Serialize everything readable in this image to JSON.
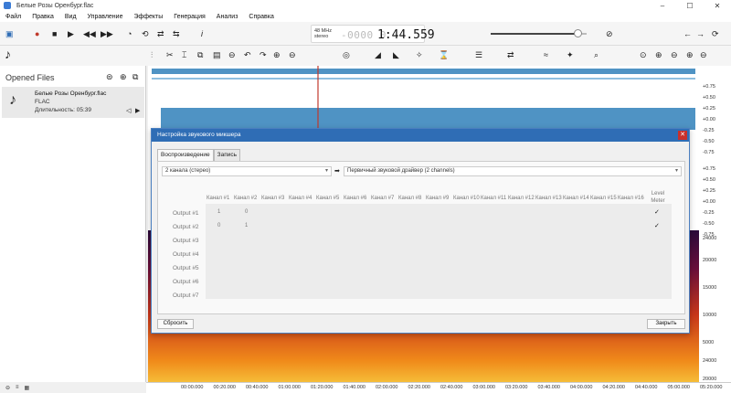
{
  "window": {
    "title": "Белые Розы Оренбург.flac"
  },
  "menu": [
    "Файл",
    "Правка",
    "Вид",
    "Управление",
    "Эффекты",
    "Генерация",
    "Анализ",
    "Справка"
  ],
  "transport": {
    "rate": "48 MHz",
    "mode": "stereo",
    "time_dim": "-0000 0",
    "time": "1:44.559"
  },
  "volume": {
    "level": 0.9
  },
  "sidebar": {
    "header": "Opened Files",
    "file": {
      "name": "Белые Розы Оренбург.flac",
      "type": "FLAC",
      "duration": "Длительность: 05:39"
    }
  },
  "ruler_labels": [
    "+0.75",
    "+0.50",
    "+0.25",
    "+0.00",
    "-0.25",
    "-0.50",
    "-0.75",
    "+0.75",
    "+0.50",
    "+0.25",
    "+0.00",
    "-0.25",
    "-0.50",
    "-0.75",
    "24000",
    "20000",
    "15000",
    "10000",
    "5000",
    "24000",
    "20000",
    "15000",
    "10000",
    "5000"
  ],
  "timeline": [
    "00:00.000",
    "00:20.000",
    "00:40.000",
    "01:00.000",
    "01:20.000",
    "01:40.000",
    "02:00.000",
    "02:20.000",
    "02:40.000",
    "03:00.000",
    "03:20.000",
    "03:40.000",
    "04:00.000",
    "04:20.000",
    "04:40.000",
    "05:00.000",
    "05:20.000"
  ],
  "dialog": {
    "title": "Настройка звукового микшера",
    "tabs": [
      "Воспроизведение",
      "Запись"
    ],
    "channels_select": "2 канала (стерео)",
    "driver_select": "Первичный звуковой драйвер (2 channels)",
    "columns": [
      "Канал #1",
      "Канал #2",
      "Канал #3",
      "Канал #4",
      "Канал #5",
      "Канал #6",
      "Канал #7",
      "Канал #8",
      "Канал #9",
      "Канал #10",
      "Канал #11",
      "Канал #12",
      "Канал #13",
      "Канал #14",
      "Канал #15",
      "Канал #16"
    ],
    "level_meter": "Level Meter",
    "rows": [
      "Output #1",
      "Output #2",
      "Output #3",
      "Output #4",
      "Output #5",
      "Output #6",
      "Output #7"
    ],
    "values": [
      [
        "1",
        "0"
      ],
      [
        "0",
        "1"
      ]
    ],
    "checks": [
      "✓",
      "✓"
    ],
    "reset": "Сбросить",
    "close": "Закрыть"
  },
  "colors": {
    "accent": "#2f6db5",
    "waveform": "#4f93c4",
    "cursor": "#c0392b"
  }
}
